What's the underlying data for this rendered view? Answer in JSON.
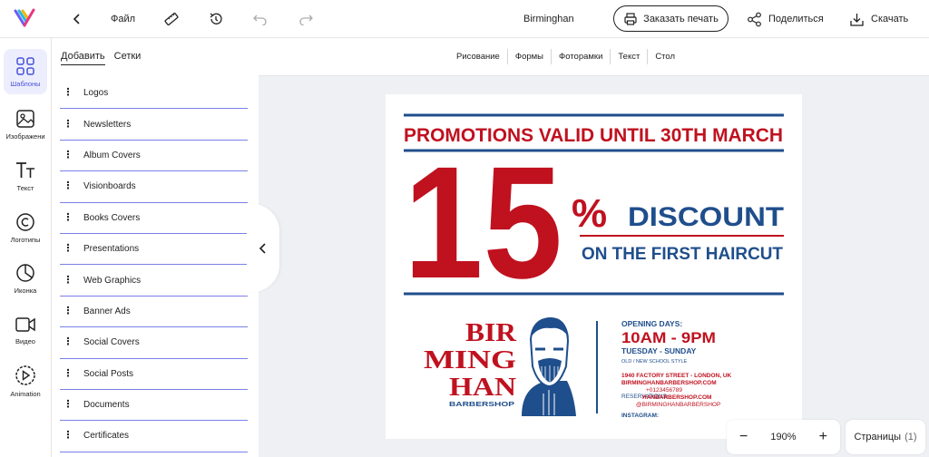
{
  "topbar": {
    "file_label": "Файл",
    "doc_name": "Birminghan",
    "print_label": "Заказать печать",
    "share_label": "Поделиться",
    "download_label": "Скачать"
  },
  "rail": {
    "items": [
      {
        "label": "Шаблоны",
        "icon": "templates-icon"
      },
      {
        "label": "Изображени",
        "icon": "image-icon"
      },
      {
        "label": "Текст",
        "icon": "text-icon"
      },
      {
        "label": "Логотипы",
        "icon": "copyright-icon"
      },
      {
        "label": "Иконка",
        "icon": "pie-icon"
      },
      {
        "label": "Видео",
        "icon": "video-icon"
      },
      {
        "label": "Animation",
        "icon": "play-icon"
      }
    ]
  },
  "panel": {
    "tabs": [
      "Добавить",
      "Сетки"
    ],
    "items": [
      "Logos",
      "Newsletters",
      "Album Covers",
      "Visionboards",
      "Books Covers",
      "Presentations",
      "Web Graphics",
      "Banner Ads",
      "Social Covers",
      "Social Posts",
      "Documents",
      "Certificates"
    ]
  },
  "tools": [
    "Рисование",
    "Формы",
    "Фоторамки",
    "Текст",
    "Стол"
  ],
  "design": {
    "promo": "PROMOTIONS VALID UNTIL 30TH MARCH",
    "big_number": "15",
    "percent": "%",
    "discount": "DISCOUNT",
    "first_haircut": "ON THE FIRST HAIRCUT",
    "logo_line1": "BIR",
    "logo_line2": "MING",
    "logo_line3": "HAN",
    "logo_sub": "BARBERSHOP",
    "opening_days": "OPENING DAYS:",
    "hours": "10AM - 9PM",
    "days": "TUESDAY - SUNDAY",
    "style": "OLD / NEW SCHOOL STYLE",
    "address": "1940 FACTORY STREET - LONDON, UK",
    "website": "BIRMINGHANBARBERSHOP.COM",
    "phone": "+0123456789",
    "reservations": "RESERVATIONS:",
    "res_email": "HANBARBERSHOP.COM",
    "insta_handle": "@BIRMINGHANBARBERSHOP",
    "instagram": "INSTAGRAM:",
    "red": "#c0111f",
    "blue": "#1f4e8c"
  },
  "zoom": {
    "level": "190%",
    "minus": "−",
    "plus": "+"
  },
  "pages": {
    "label": "Страницы",
    "count": "(1)"
  }
}
